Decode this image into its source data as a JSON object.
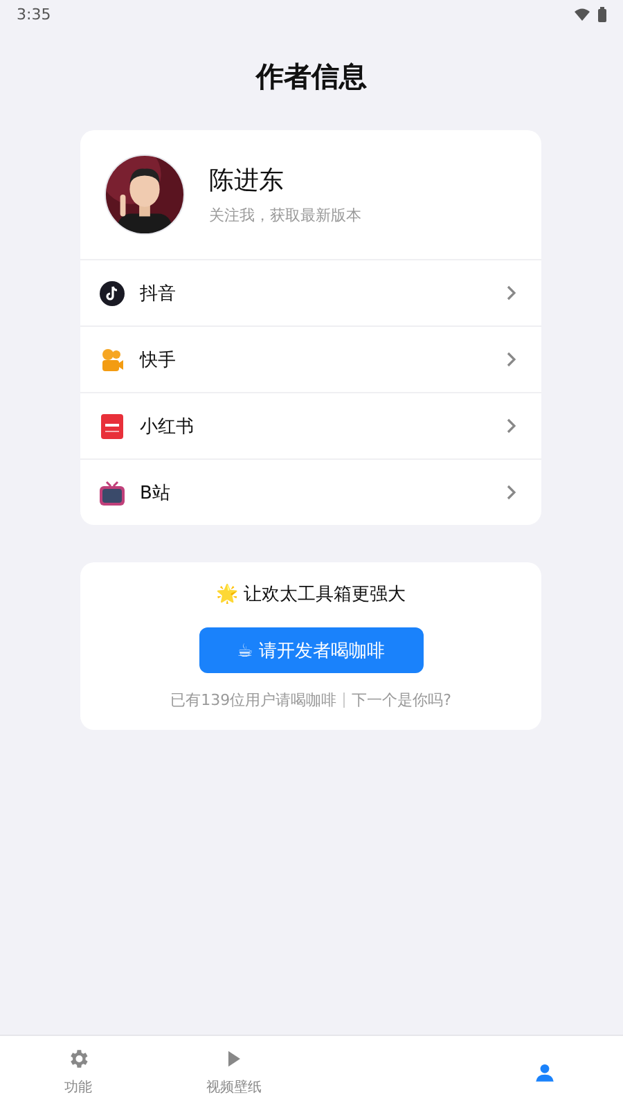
{
  "status_bar": {
    "time": "3:35"
  },
  "title": "作者信息",
  "author": {
    "name": "陈进东",
    "subtitle": "关注我，获取最新版本"
  },
  "links": [
    {
      "kind": "douyin",
      "label": "抖音"
    },
    {
      "kind": "kuaishou",
      "label": "快手"
    },
    {
      "kind": "xiaohongshu",
      "label": "小红书"
    },
    {
      "kind": "bilibili",
      "label": "B站"
    }
  ],
  "support": {
    "headline": "🌟 让欢太工具箱更强大",
    "button": "☕ 请开发者喝咖啡",
    "note_left": "已有139位用户请喝咖啡",
    "note_right": "下一个是你吗?"
  },
  "bottom_nav": [
    {
      "kind": "gear",
      "label": "功能",
      "selected": false
    },
    {
      "kind": "play",
      "label": "视频壁纸",
      "selected": false
    },
    {
      "kind": "person",
      "selected": true
    }
  ]
}
